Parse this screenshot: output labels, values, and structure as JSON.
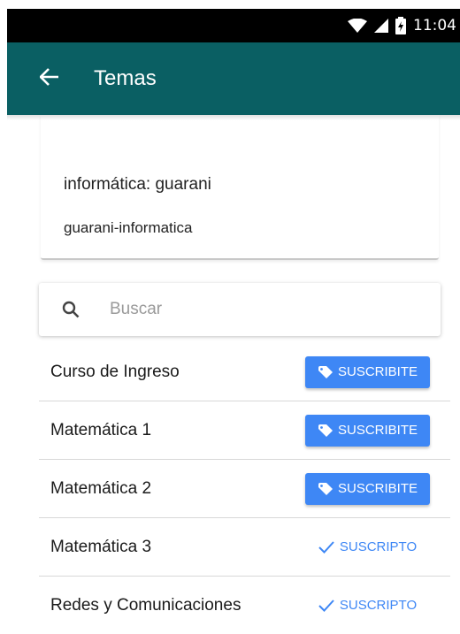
{
  "status_bar": {
    "time": "11:04",
    "icons": [
      "wifi-icon",
      "signal-icon",
      "battery-icon"
    ],
    "background": "#000000"
  },
  "app_bar": {
    "title": "Temas",
    "back_icon": "arrow-back-icon",
    "background": "#0a5f63"
  },
  "subscription": {
    "name": "informática: guarani",
    "slug": "guarani-informatica"
  },
  "search": {
    "placeholder": "Buscar",
    "value": "",
    "icon": "search-icon"
  },
  "colors": {
    "accent": "#3e87f5",
    "divider": "#d8d8d8"
  },
  "topics": [
    {
      "name": "Curso de Ingreso",
      "action": "SUSCRIBITE",
      "subscribed": false
    },
    {
      "name": "Matemática 1",
      "action": "SUSCRIBITE",
      "subscribed": false
    },
    {
      "name": "Matemática 2",
      "action": "SUSCRIBITE",
      "subscribed": false
    },
    {
      "name": "Matemática 3",
      "action": "SUSCRIPTO",
      "subscribed": true
    },
    {
      "name": "Redes y Comunicaciones",
      "action": "SUSCRIPTO",
      "subscribed": true
    }
  ]
}
